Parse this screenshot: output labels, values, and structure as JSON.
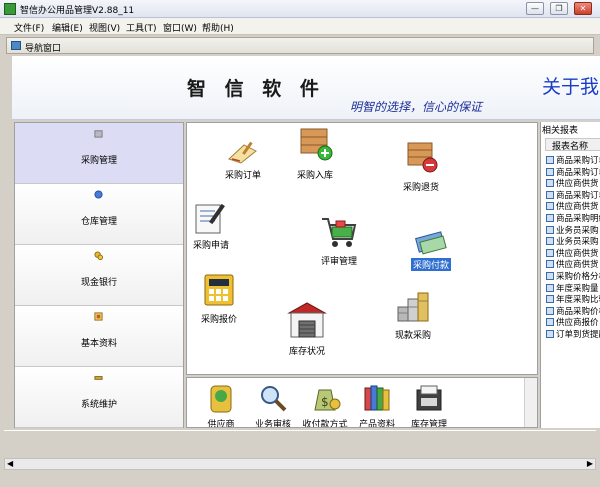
{
  "window": {
    "title": "智信办公用品管理V2.88_11",
    "minimize_glyph": "—",
    "restore_glyph": "❐",
    "close_glyph": "✕"
  },
  "menu": [
    "文件(F)",
    "编辑(E)",
    "视图(V)",
    "工具(T)",
    "窗口(W)",
    "帮助(H)"
  ],
  "nav_window": {
    "title": "导航窗口"
  },
  "banner": {
    "brand": "智 信 软 件",
    "about": "关于我",
    "slogan": "明智的选择，信心的保证"
  },
  "sidebar": {
    "items": [
      {
        "label": "采购管理",
        "active": true
      },
      {
        "label": "仓库管理"
      },
      {
        "label": "现金银行"
      },
      {
        "label": "基本资料"
      },
      {
        "label": "系统维护"
      }
    ]
  },
  "functions": {
    "purchase_order": "采购订单",
    "purchase_inbound": "采购入库",
    "purchase_return": "采购退货",
    "purchase_request": "采购申请",
    "review_management": "评审管理",
    "purchase_payment": "采购付款",
    "purchase_quote": "采购报价",
    "inventory_status": "库存状况",
    "spot_purchase": "现款采购"
  },
  "bottom_tools": [
    "供应商",
    "业务审核",
    "收付款方式",
    "产品资料",
    "库存管理"
  ],
  "reports": {
    "header": "相关报表",
    "column": "报表名称",
    "items": [
      "商品采购订单",
      "商品采购订单",
      "供应商供货",
      "商品采购订单",
      "供应商供货",
      "商品采购明细",
      "业务员采购",
      "业务员采购",
      "供应商供货",
      "供应商供货",
      "采购价格分析",
      "年度采购量",
      "年度采购比较",
      "商品采购价格",
      "供应商报价",
      "订单到货提醒"
    ]
  },
  "colors": {
    "brand_blue": "#1a3cc8",
    "active_nav": "#dcdcf4",
    "payment_highlight": "#2f6fd0"
  }
}
